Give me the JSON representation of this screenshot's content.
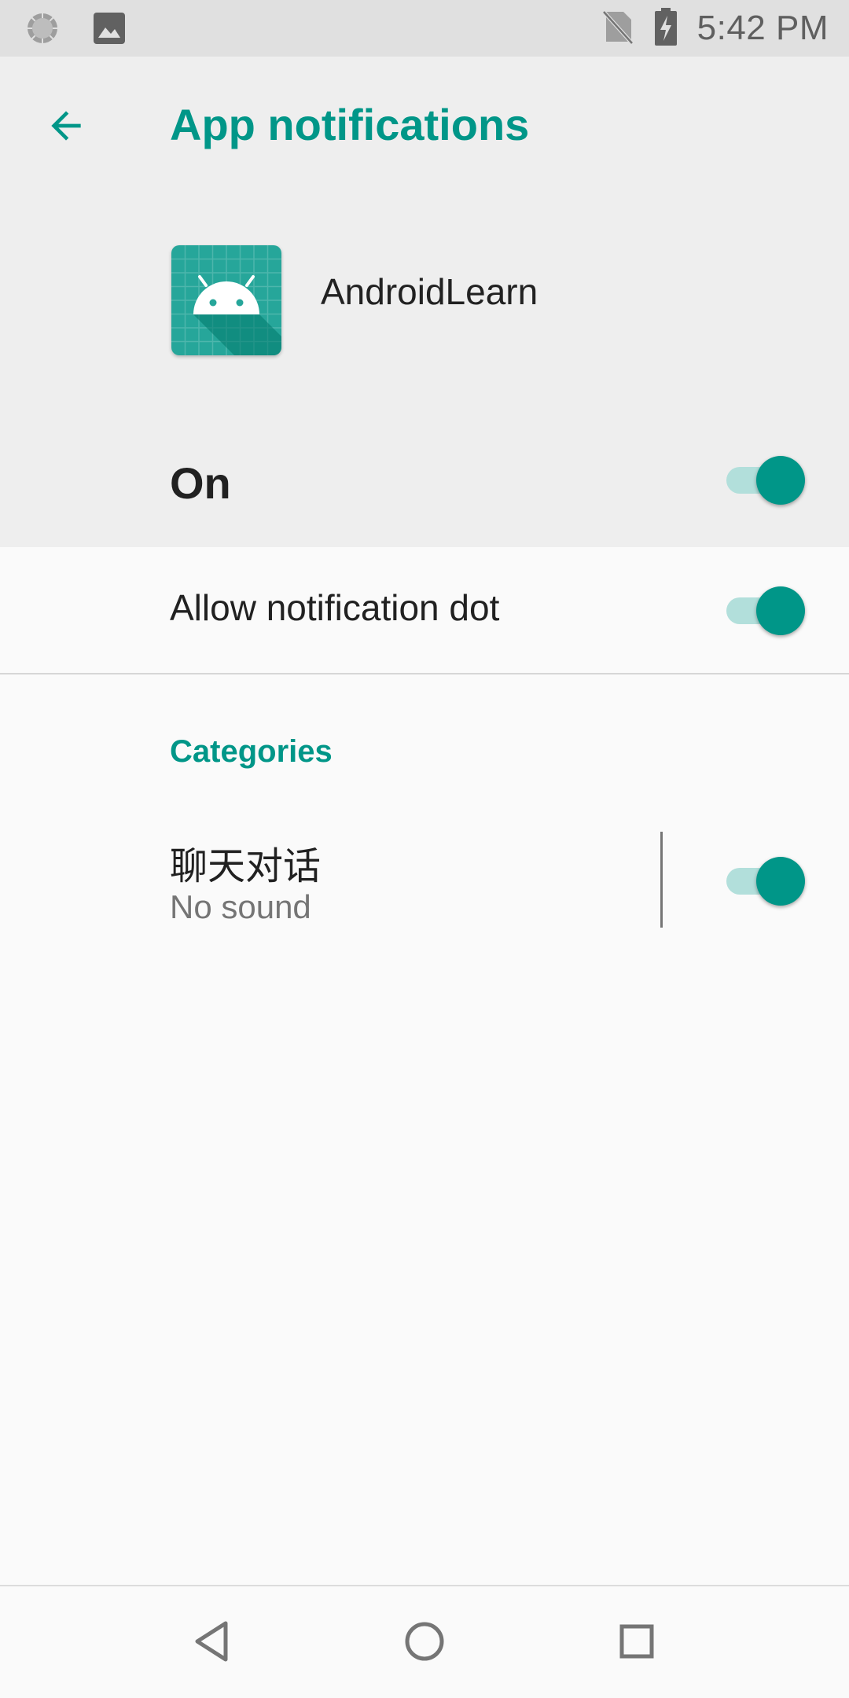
{
  "status_bar": {
    "time": "5:42 PM",
    "left_icons": [
      "loading-circle-icon",
      "image-icon"
    ],
    "right_icons": [
      "no-sim-icon",
      "battery-charging-icon"
    ]
  },
  "header": {
    "title": "App notifications",
    "back_icon": "arrow-back-icon"
  },
  "app": {
    "name": "AndroidLearn",
    "icon": "android-app-icon"
  },
  "main_toggle": {
    "label": "On",
    "checked": true
  },
  "notification_dot": {
    "label": "Allow notification dot",
    "checked": true
  },
  "categories": {
    "header": "Categories",
    "items": [
      {
        "title": "聊天对话",
        "summary": "No sound",
        "checked": true
      }
    ]
  },
  "nav_bar": {
    "buttons": [
      "back-triangle-icon",
      "home-circle-icon",
      "recents-square-icon"
    ]
  },
  "colors": {
    "accent": "#009688",
    "accent_light": "#b2dfdb",
    "header_bg": "#eeeeee",
    "body_bg": "#fafafa",
    "status_bar_bg": "#e0e0e0"
  }
}
